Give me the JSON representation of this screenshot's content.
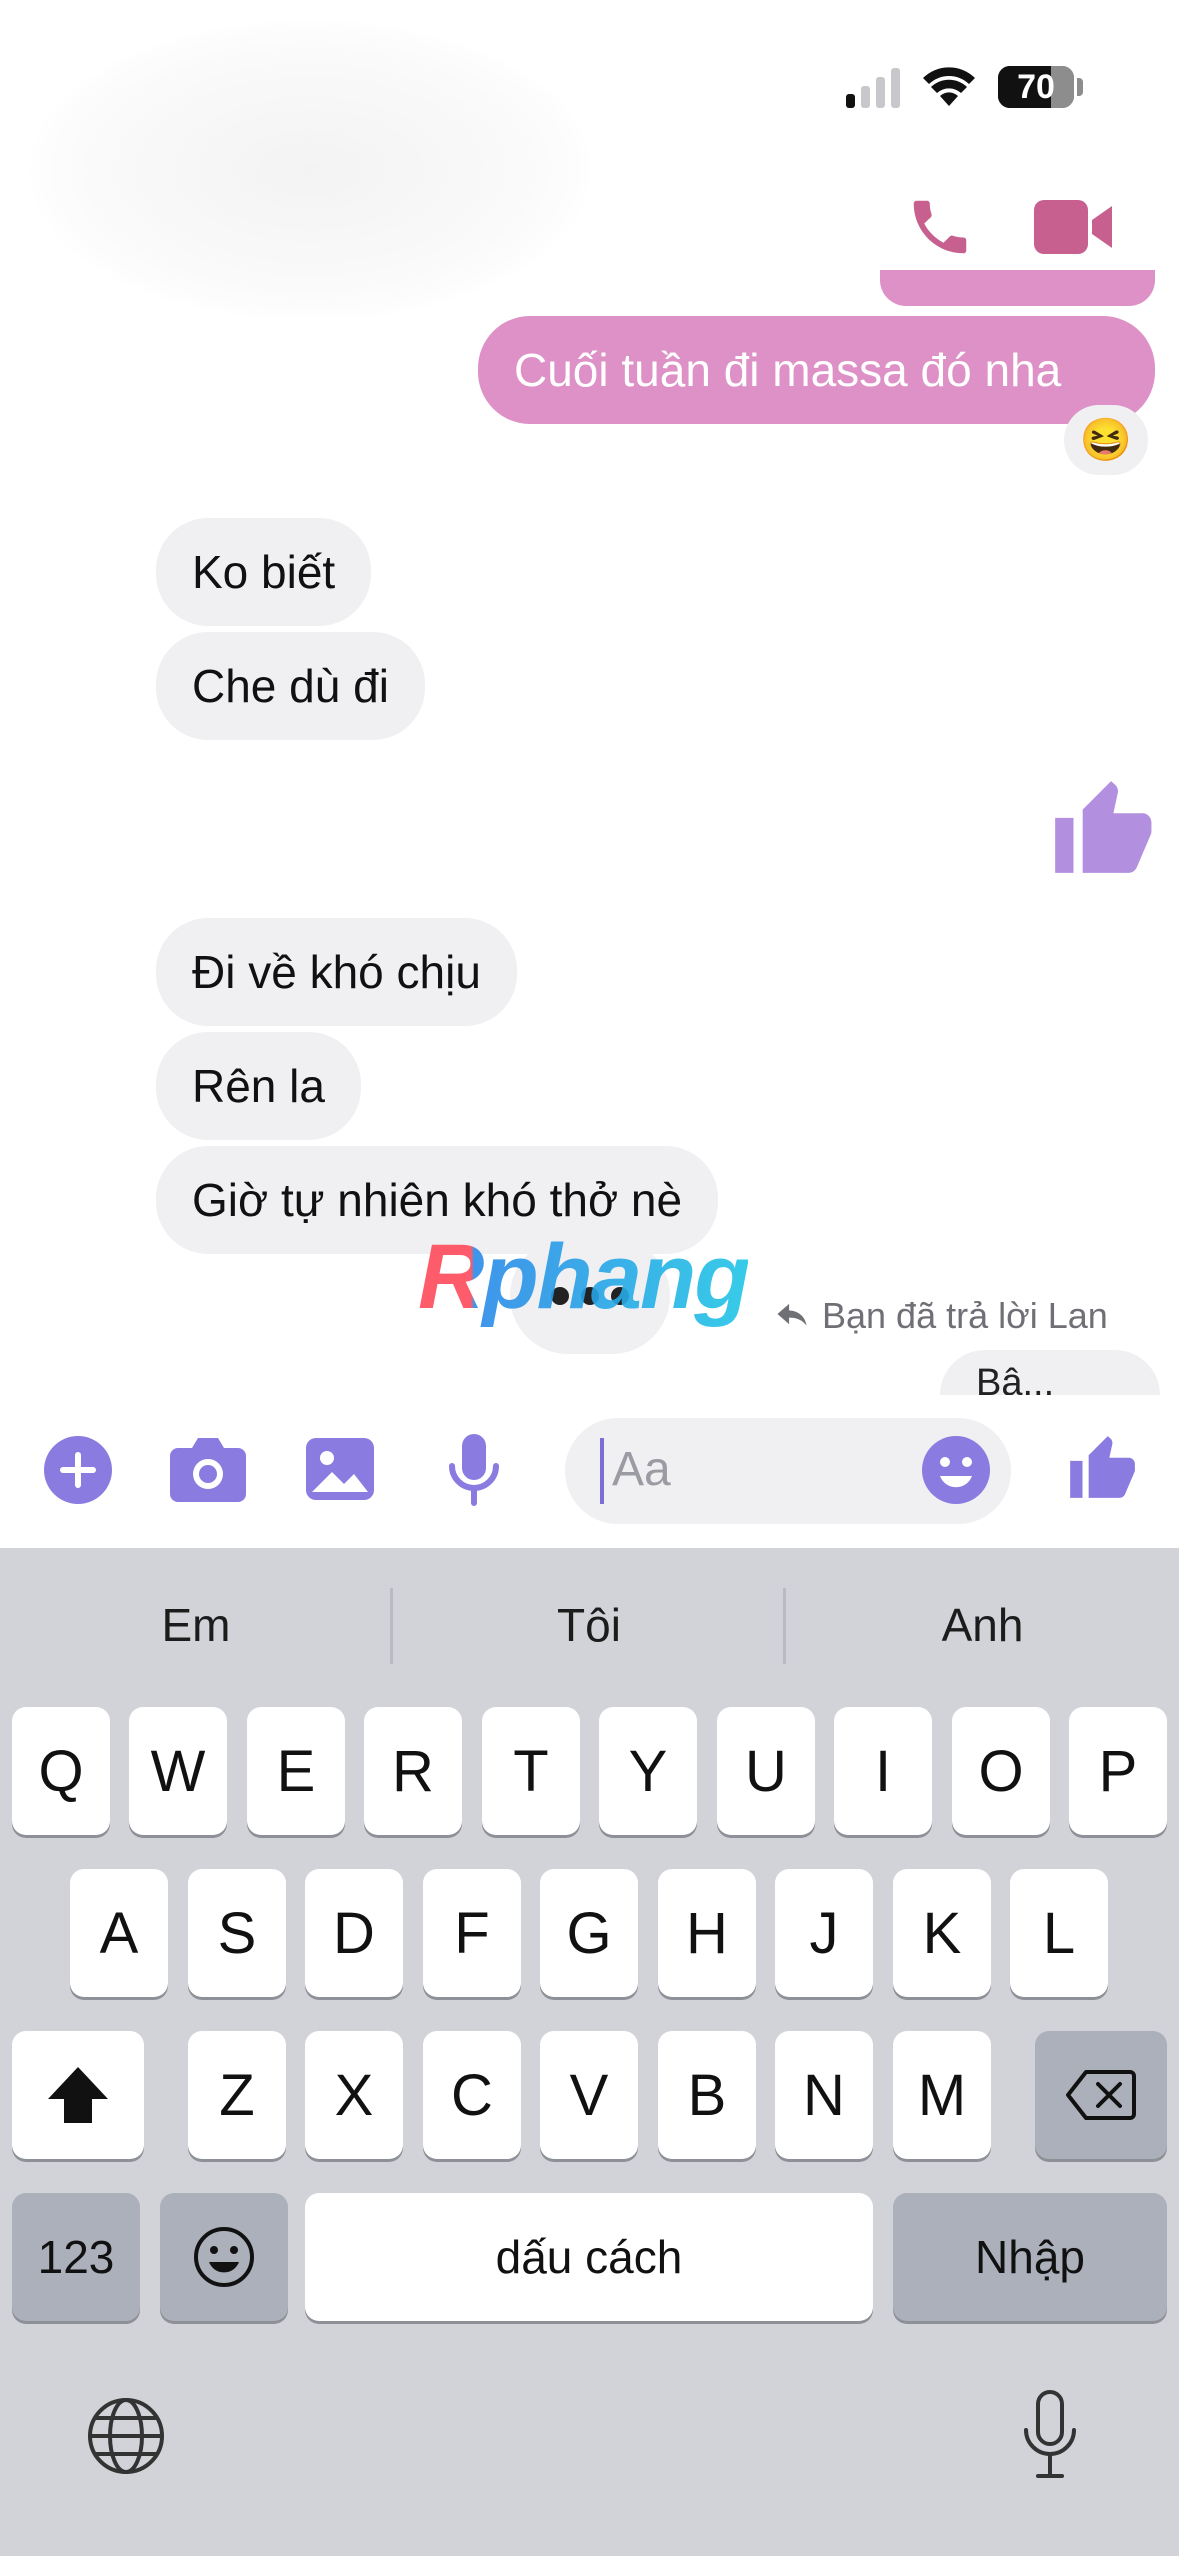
{
  "status_bar": {
    "battery": "70"
  },
  "messages": {
    "outgoing_1": "Cuối tuần đi massa đó nha",
    "reaction_emoji": "😆",
    "incoming_1": "Ko biết",
    "incoming_2": "Che dù đi",
    "incoming_3": "Đi về khó chịu",
    "incoming_4": "Rên la",
    "incoming_5": "Giờ tự nhiên khó thở nè",
    "reply_note": "Bạn đã trả lời Lan",
    "partial_bubble": "Bậ..."
  },
  "watermark": "Rphang",
  "input": {
    "placeholder": "Aa"
  },
  "keyboard": {
    "suggestions": [
      "Em",
      "Tôi",
      "Anh"
    ],
    "row1": [
      "Q",
      "W",
      "E",
      "R",
      "T",
      "Y",
      "U",
      "I",
      "O",
      "P"
    ],
    "row2": [
      "A",
      "S",
      "D",
      "F",
      "G",
      "H",
      "J",
      "K",
      "L"
    ],
    "row3": [
      "Z",
      "X",
      "C",
      "V",
      "B",
      "N",
      "M"
    ],
    "numbers_label": "123",
    "space_label": "dấu cách",
    "return_label": "Nhập"
  },
  "colors": {
    "accent": "#8a7be0",
    "outgoing_bubble": "#dd91c6",
    "call_icon": "#c7608f",
    "like": "#b38fe0"
  }
}
